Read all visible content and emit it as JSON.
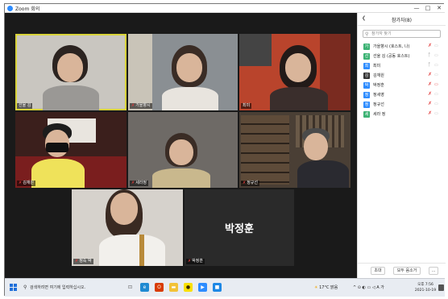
{
  "window": {
    "title": "Zoom 회의",
    "controls": [
      "—",
      "□",
      "✕"
    ]
  },
  "tiles": [
    {
      "name": "선울 김",
      "active": true,
      "bg": "#c9c6c0"
    },
    {
      "name": "가을향시",
      "active": false,
      "bg": "#8a8f93"
    },
    {
      "name": "최미",
      "active": false,
      "bg": "#b9442c"
    },
    {
      "name": "김재원",
      "active": false,
      "bg": "#3b1f1c"
    },
    {
      "name": "세라정",
      "active": false,
      "bg": "#6e6a66"
    },
    {
      "name": "정규선",
      "active": false,
      "bg": "#4a3f35"
    },
    {
      "name": "정숙 박",
      "active": false,
      "bg": "#d6d2cc"
    },
    {
      "name": "박정훈",
      "active": false,
      "bg": "#2a2a2a",
      "big_name": "박정훈"
    }
  ],
  "panel": {
    "title": "참가자(8)",
    "collapse_icon": "chevron-left-icon",
    "search_placeholder": "참가자 찾기",
    "participants": [
      {
        "initial": "가",
        "name": "가을향시 (호스트, 나)",
        "color": "#3bb273",
        "mic_muted": true
      },
      {
        "initial": "선",
        "name": "선울 김 (공동 호스트)",
        "color": "#3bb273",
        "mic_muted": false
      },
      {
        "initial": "최",
        "name": "최미",
        "color": "#2d8cff",
        "mic_muted": false
      },
      {
        "initial": "김",
        "name": "김재원",
        "color": "#333333",
        "mic_muted": true
      },
      {
        "initial": "박",
        "name": "박정훈",
        "color": "#2d8cff",
        "mic_muted": true
      },
      {
        "initial": "정",
        "name": "정세영",
        "color": "#2d8cff",
        "mic_muted": true
      },
      {
        "initial": "정",
        "name": "정규선",
        "color": "#2d8cff",
        "mic_muted": true
      },
      {
        "initial": "세",
        "name": "세라 정",
        "color": "#3bb273",
        "mic_muted": true
      }
    ],
    "invite_button": "초대",
    "mute_all_button": "모두 음소거",
    "more_button": "..."
  },
  "taskbar": {
    "search_placeholder": "검색하려면 여기에 입력하십시오.",
    "apps": [
      {
        "icon": "task-view-icon",
        "color": "#555555",
        "glyph": "⊡"
      },
      {
        "icon": "edge-icon",
        "color": "#1f8ad2",
        "glyph": "e"
      },
      {
        "icon": "office-icon",
        "color": "#d83b01",
        "glyph": "O"
      },
      {
        "icon": "file-explorer-icon",
        "color": "#f2c237",
        "glyph": "▬"
      },
      {
        "icon": "kakaotalk-icon",
        "color": "#f9e000",
        "glyph": "●"
      },
      {
        "icon": "zoom-icon",
        "color": "#2d8cff",
        "glyph": "▶"
      },
      {
        "icon": "app-icon",
        "color": "#1e88e5",
        "glyph": "■"
      }
    ],
    "weather": "17°C 맑음",
    "tray_icons": "^ ⊙ ◐ ▭ ◁ A 가",
    "time": "오후 7:56",
    "date": "2021-10-19"
  }
}
